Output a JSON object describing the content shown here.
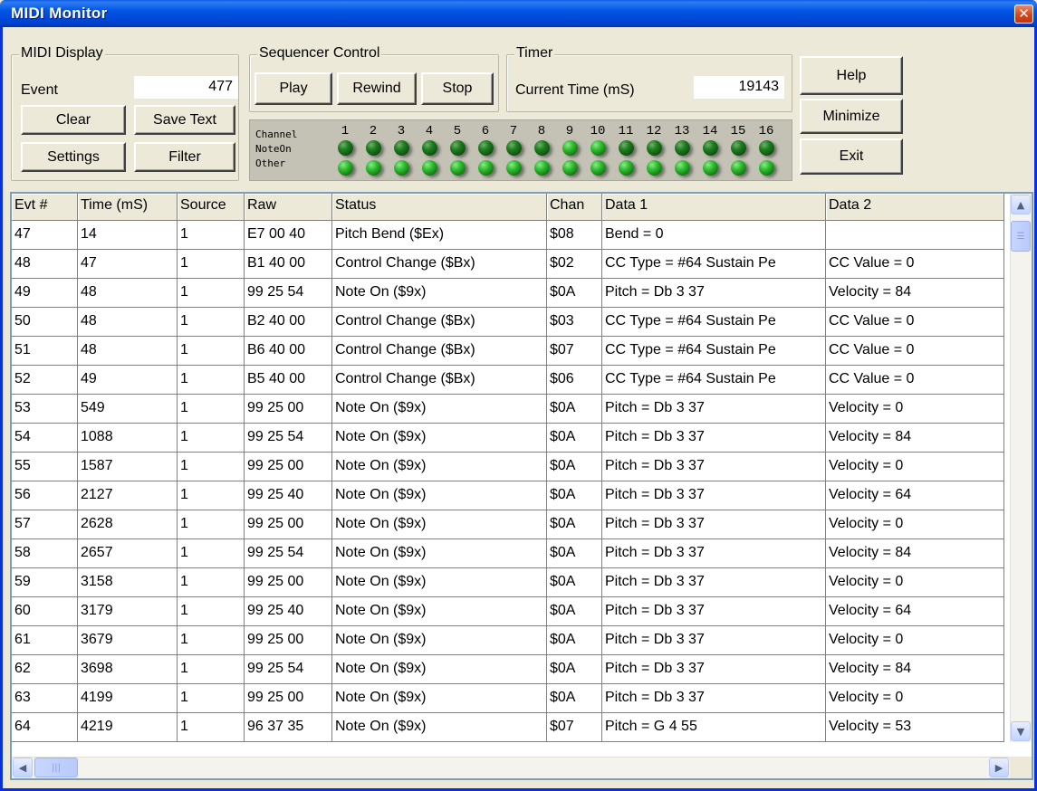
{
  "window": {
    "title": "MIDI Monitor",
    "close_glyph": "✕"
  },
  "midi_display": {
    "legend": "MIDI Display",
    "event_label": "Event",
    "event_value": "477",
    "clear_label": "Clear",
    "save_text_label": "Save Text",
    "settings_label": "Settings",
    "filter_label": "Filter"
  },
  "sequencer": {
    "legend": "Sequencer Control",
    "play_label": "Play",
    "rewind_label": "Rewind",
    "stop_label": "Stop"
  },
  "timer": {
    "legend": "Timer",
    "current_time_label": "Current Time (mS)",
    "current_time_value": "19143"
  },
  "side_buttons": {
    "help_label": "Help",
    "minimize_label": "Minimize",
    "exit_label": "Exit"
  },
  "channel_panel": {
    "channel_label": "Channel",
    "noteon_label": "NoteOn",
    "other_label": "Other",
    "channels": [
      "1",
      "2",
      "3",
      "4",
      "5",
      "6",
      "7",
      "8",
      "9",
      "10",
      "11",
      "12",
      "13",
      "14",
      "15",
      "16"
    ]
  },
  "table": {
    "columns": [
      "Evt #",
      "Time (mS)",
      "Source",
      "Raw",
      "Status",
      "Chan",
      "Data 1",
      "Data 2"
    ],
    "rows": [
      [
        "47",
        "14",
        "1",
        "E7 00 40",
        "Pitch Bend ($Ex)",
        "$08",
        "Bend = 0",
        ""
      ],
      [
        "48",
        "47",
        "1",
        "B1 40 00",
        "Control Change ($Bx)",
        "$02",
        "CC Type = #64 Sustain Pe",
        "CC Value =  0"
      ],
      [
        "49",
        "48",
        "1",
        "99 25 54",
        "Note On ($9x)",
        "$0A",
        "Pitch = Db  3  37",
        "Velocity =  84"
      ],
      [
        "50",
        "48",
        "1",
        "B2 40 00",
        "Control Change ($Bx)",
        "$03",
        "CC Type = #64 Sustain Pe",
        "CC Value =  0"
      ],
      [
        "51",
        "48",
        "1",
        "B6 40 00",
        "Control Change ($Bx)",
        "$07",
        "CC Type = #64 Sustain Pe",
        "CC Value =  0"
      ],
      [
        "52",
        "49",
        "1",
        "B5 40 00",
        "Control Change ($Bx)",
        "$06",
        "CC Type = #64 Sustain Pe",
        "CC Value =  0"
      ],
      [
        "53",
        "549",
        "1",
        "99 25 00",
        "Note On ($9x)",
        "$0A",
        "Pitch = Db  3  37",
        "Velocity =  0"
      ],
      [
        "54",
        "1088",
        "1",
        "99 25 54",
        "Note On ($9x)",
        "$0A",
        "Pitch = Db  3  37",
        "Velocity =  84"
      ],
      [
        "55",
        "1587",
        "1",
        "99 25 00",
        "Note On ($9x)",
        "$0A",
        "Pitch = Db  3  37",
        "Velocity =  0"
      ],
      [
        "56",
        "2127",
        "1",
        "99 25 40",
        "Note On ($9x)",
        "$0A",
        "Pitch = Db  3  37",
        "Velocity =  64"
      ],
      [
        "57",
        "2628",
        "1",
        "99 25 00",
        "Note On ($9x)",
        "$0A",
        "Pitch = Db  3  37",
        "Velocity =  0"
      ],
      [
        "58",
        "2657",
        "1",
        "99 25 54",
        "Note On ($9x)",
        "$0A",
        "Pitch = Db  3  37",
        "Velocity =  84"
      ],
      [
        "59",
        "3158",
        "1",
        "99 25 00",
        "Note On ($9x)",
        "$0A",
        "Pitch = Db  3  37",
        "Velocity =  0"
      ],
      [
        "60",
        "3179",
        "1",
        "99 25 40",
        "Note On ($9x)",
        "$0A",
        "Pitch = Db  3  37",
        "Velocity =  64"
      ],
      [
        "61",
        "3679",
        "1",
        "99 25 00",
        "Note On ($9x)",
        "$0A",
        "Pitch = Db  3  37",
        "Velocity =  0"
      ],
      [
        "62",
        "3698",
        "1",
        "99 25 54",
        "Note On ($9x)",
        "$0A",
        "Pitch = Db  3  37",
        "Velocity =  84"
      ],
      [
        "63",
        "4199",
        "1",
        "99 25 00",
        "Note On ($9x)",
        "$0A",
        "Pitch = Db  3  37",
        "Velocity =  0"
      ],
      [
        "64",
        "4219",
        "1",
        "96 37 35",
        "Note On ($9x)",
        "$07",
        "Pitch = G  4  55",
        "Velocity =  53"
      ]
    ]
  },
  "colors": {
    "titlebar": "#0055e5",
    "led_green": "#2fbf2f",
    "face": "#ece9d8"
  }
}
